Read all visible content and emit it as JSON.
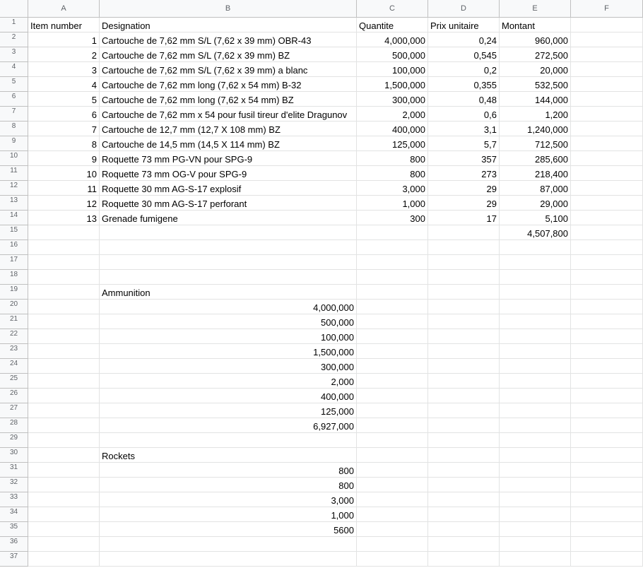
{
  "columns": [
    "A",
    "B",
    "C",
    "D",
    "E",
    "F"
  ],
  "row_numbers": [
    "1",
    "2",
    "3",
    "4",
    "5",
    "6",
    "7",
    "8",
    "9",
    "10",
    "11",
    "12",
    "13",
    "14",
    "15",
    "16",
    "17",
    "18",
    "19",
    "20",
    "21",
    "22",
    "23",
    "24",
    "25",
    "26",
    "27",
    "28",
    "29",
    "30",
    "31",
    "32",
    "33",
    "34",
    "35",
    "36",
    "37"
  ],
  "rows": [
    [
      "Item number",
      "Designation",
      "Quantite",
      "Prix unitaire",
      "Montant",
      ""
    ],
    [
      "1",
      "Cartouche de 7,62 mm S/L (7,62 x 39 mm) OBR-43",
      "4,000,000",
      "0,24",
      "960,000",
      ""
    ],
    [
      "2",
      "Cartouche de 7,62 mm S/L (7,62 x 39 mm) BZ",
      "500,000",
      "0,545",
      "272,500",
      ""
    ],
    [
      "3",
      "Cartouche de 7,62 mm S/L (7,62 x 39 mm) a blanc",
      "100,000",
      "0,2",
      "20,000",
      ""
    ],
    [
      "4",
      "Cartouche de 7,62 mm long (7,62 x 54 mm) B-32",
      "1,500,000",
      "0,355",
      "532,500",
      ""
    ],
    [
      "5",
      "Cartouche de 7,62 mm long (7,62 x 54 mm) BZ",
      "300,000",
      "0,48",
      "144,000",
      ""
    ],
    [
      "6",
      "Cartouche de 7,62 mm x 54 pour fusil tireur d'elite Dragunov",
      "2,000",
      "0,6",
      "1,200",
      ""
    ],
    [
      "7",
      "Cartouche de 12,7 mm (12,7 X 108 mm) BZ",
      "400,000",
      "3,1",
      "1,240,000",
      ""
    ],
    [
      "8",
      "Cartouche de 14,5 mm (14,5 X 114 mm) BZ",
      "125,000",
      "5,7",
      "712,500",
      ""
    ],
    [
      "9",
      "Roquette 73 mm PG-VN pour SPG-9",
      "800",
      "357",
      "285,600",
      ""
    ],
    [
      "10",
      "Roquette 73 mm OG-V pour SPG-9",
      "800",
      "273",
      "218,400",
      ""
    ],
    [
      "11",
      "Roquette 30 mm AG-S-17 explosif",
      "3,000",
      "29",
      "87,000",
      ""
    ],
    [
      "12",
      "Roquette 30 mm AG-S-17 perforant",
      "1,000",
      "29",
      "29,000",
      ""
    ],
    [
      "13",
      "Grenade fumigene",
      "300",
      "17",
      "5,100",
      ""
    ],
    [
      "",
      "",
      "",
      "",
      "4,507,800",
      ""
    ],
    [
      "",
      "",
      "",
      "",
      "",
      ""
    ],
    [
      "",
      "",
      "",
      "",
      "",
      ""
    ],
    [
      "",
      "",
      "",
      "",
      "",
      ""
    ],
    [
      "",
      "Ammunition",
      "",
      "",
      "",
      ""
    ],
    [
      "",
      "4,000,000",
      "",
      "",
      "",
      ""
    ],
    [
      "",
      "500,000",
      "",
      "",
      "",
      ""
    ],
    [
      "",
      "100,000",
      "",
      "",
      "",
      ""
    ],
    [
      "",
      "1,500,000",
      "",
      "",
      "",
      ""
    ],
    [
      "",
      "300,000",
      "",
      "",
      "",
      ""
    ],
    [
      "",
      "2,000",
      "",
      "",
      "",
      ""
    ],
    [
      "",
      "400,000",
      "",
      "",
      "",
      ""
    ],
    [
      "",
      "125,000",
      "",
      "",
      "",
      ""
    ],
    [
      "",
      "6,927,000",
      "",
      "",
      "",
      ""
    ],
    [
      "",
      "",
      "",
      "",
      "",
      ""
    ],
    [
      "",
      "Rockets",
      "",
      "",
      "",
      ""
    ],
    [
      "",
      "800",
      "",
      "",
      "",
      ""
    ],
    [
      "",
      "800",
      "",
      "",
      "",
      ""
    ],
    [
      "",
      "3,000",
      "",
      "",
      "",
      ""
    ],
    [
      "",
      "1,000",
      "",
      "",
      "",
      ""
    ],
    [
      "",
      "5600",
      "",
      "",
      "",
      ""
    ],
    [
      "",
      "",
      "",
      "",
      "",
      ""
    ],
    [
      "",
      "",
      "",
      "",
      "",
      ""
    ]
  ],
  "colors": {
    "header_bg": "#f8f9fa",
    "header_text": "#5f6368",
    "gridline": "#e2e3e3"
  }
}
